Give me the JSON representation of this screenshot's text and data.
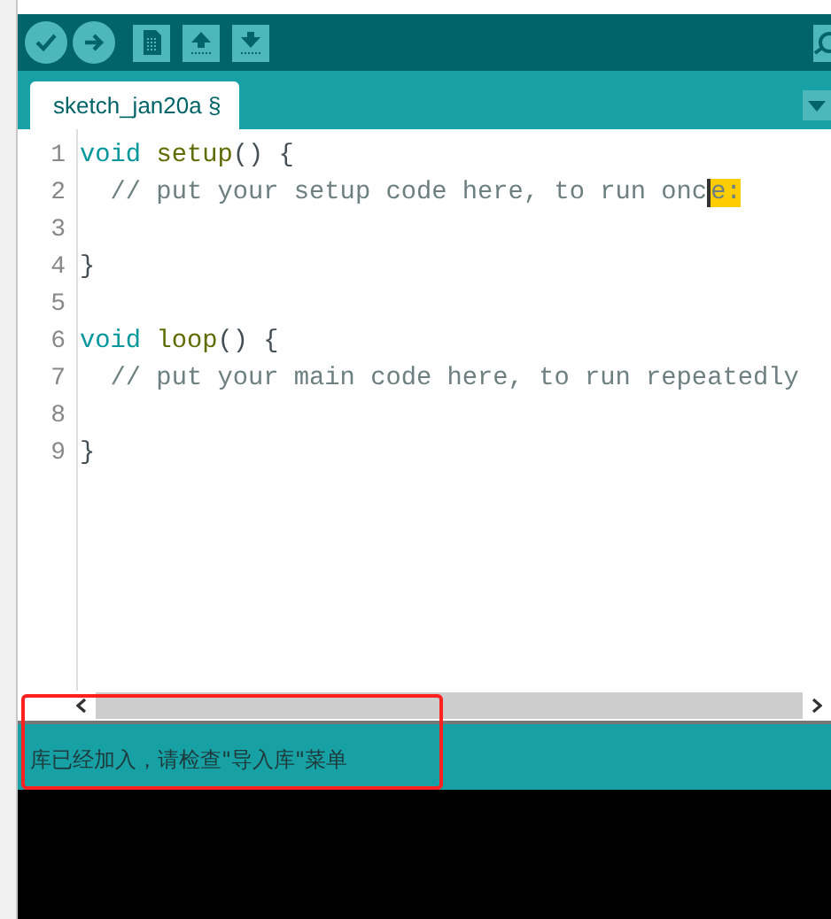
{
  "toolbar": {
    "buttons": [
      {
        "kind": "verify"
      },
      {
        "kind": "upload"
      },
      {
        "kind": "new"
      },
      {
        "kind": "open"
      },
      {
        "kind": "save"
      }
    ],
    "right": {
      "kind": "serial"
    }
  },
  "tabs": [
    {
      "label": "sketch_jan20a §",
      "selected": true
    }
  ],
  "editor": {
    "lines": [
      {
        "number": "1",
        "tokens": [
          {
            "kind": "keyword",
            "text": "void "
          },
          {
            "kind": "function",
            "text": "setup"
          },
          {
            "kind": "brace",
            "text": "() {"
          }
        ]
      },
      {
        "number": "2",
        "tokens": [
          {
            "kind": "comment",
            "text": "  // put your setup code here, to run onc"
          },
          {
            "kind": "cursor",
            "text": "e:"
          }
        ]
      },
      {
        "number": "3"
      },
      {
        "number": "4",
        "tokens": [
          {
            "kind": "brace",
            "text": "}"
          }
        ]
      },
      {
        "number": "5"
      },
      {
        "number": "6",
        "tokens": [
          {
            "kind": "keyword",
            "text": "void "
          },
          {
            "kind": "function",
            "text": "loop"
          },
          {
            "kind": "brace",
            "text": "() {"
          }
        ]
      },
      {
        "number": "7",
        "tokens": [
          {
            "kind": "comment",
            "text": "  // put your main code here, to run repeatedly"
          }
        ]
      },
      {
        "number": "8"
      },
      {
        "number": "9",
        "tokens": [
          {
            "kind": "brace",
            "text": "}"
          }
        ]
      }
    ]
  },
  "status": {
    "message": "库已经加入，请检查\"导入库\"菜单"
  }
}
